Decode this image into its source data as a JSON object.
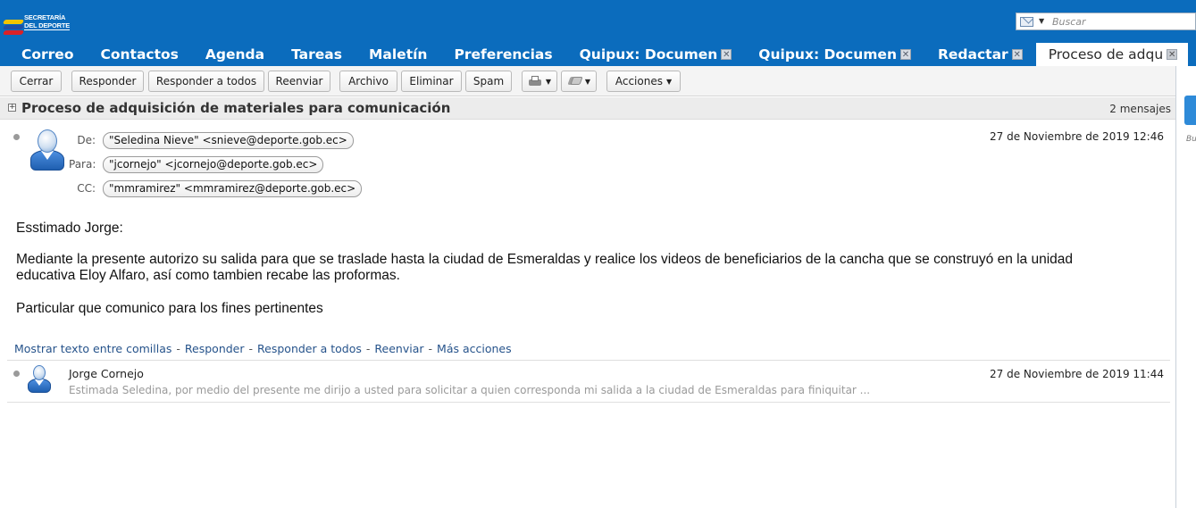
{
  "logo": {
    "line1": "SECRETARÍA",
    "line2": "DEL DEPORTE"
  },
  "search": {
    "placeholder": "Buscar"
  },
  "tabs": [
    {
      "label": "Correo",
      "closable": false
    },
    {
      "label": "Contactos",
      "closable": false
    },
    {
      "label": "Agenda",
      "closable": false
    },
    {
      "label": "Tareas",
      "closable": false
    },
    {
      "label": "Maletín",
      "closable": false
    },
    {
      "label": "Preferencias",
      "closable": false
    },
    {
      "label": "Quipux: Documen",
      "closable": true
    },
    {
      "label": "Quipux: Documen",
      "closable": true
    },
    {
      "label": "Redactar",
      "closable": true
    },
    {
      "label": "Proceso de adqu",
      "closable": true,
      "active": true
    }
  ],
  "close_glyph": "✕",
  "toolbar": {
    "close": "Cerrar",
    "reply": "Responder",
    "reply_all": "Responder a todos",
    "forward": "Reenviar",
    "archive": "Archivo",
    "delete": "Eliminar",
    "spam": "Spam",
    "actions": "Acciones"
  },
  "conversation": {
    "title": "Proceso de adquisición de materiales para comunicación",
    "count": "2 mensajes"
  },
  "message1": {
    "from_label": "De:",
    "to_label": "Para:",
    "cc_label": "CC:",
    "from": "\"Seledina Nieve\" <snieve@deporte.gob.ec>",
    "to": "\"jcornejo\" <jcornejo@deporte.gob.ec>",
    "cc": "\"mmramirez\" <mmramirez@deporte.gob.ec>",
    "date": "27 de Noviembre de 2019 12:46",
    "greeting": "Esstimado Jorge:",
    "para1_line1": "Mediante la presente autorizo su salida para que se traslade hasta la ciudad de Esmeraldas y realice los videos de beneficiarios de la cancha que se construyó en la unidad",
    "para1_line2": "educativa Eloy Alfaro, así como tambien recabe las proformas.",
    "para2": "Particular que comunico para los fines pertinentes"
  },
  "message_links": {
    "show_quoted": "Mostrar texto entre comillas",
    "reply": "Responder",
    "reply_all": "Responder a todos",
    "forward": "Reenviar",
    "more": "Más acciones",
    "sep": "-"
  },
  "message2": {
    "from": "Jorge Cornejo",
    "date": "27 de Noviembre de 2019 11:44",
    "snippet": "Estimada Seledina, por medio del presente me dirijo a usted para solicitar a quien corresponda mi salida a la ciudad de Esmeraldas para finiquitar ..."
  },
  "right_strip": {
    "text": "Bu"
  },
  "colors": {
    "header_blue": "#0b6cbd",
    "link_blue": "#26538b"
  }
}
